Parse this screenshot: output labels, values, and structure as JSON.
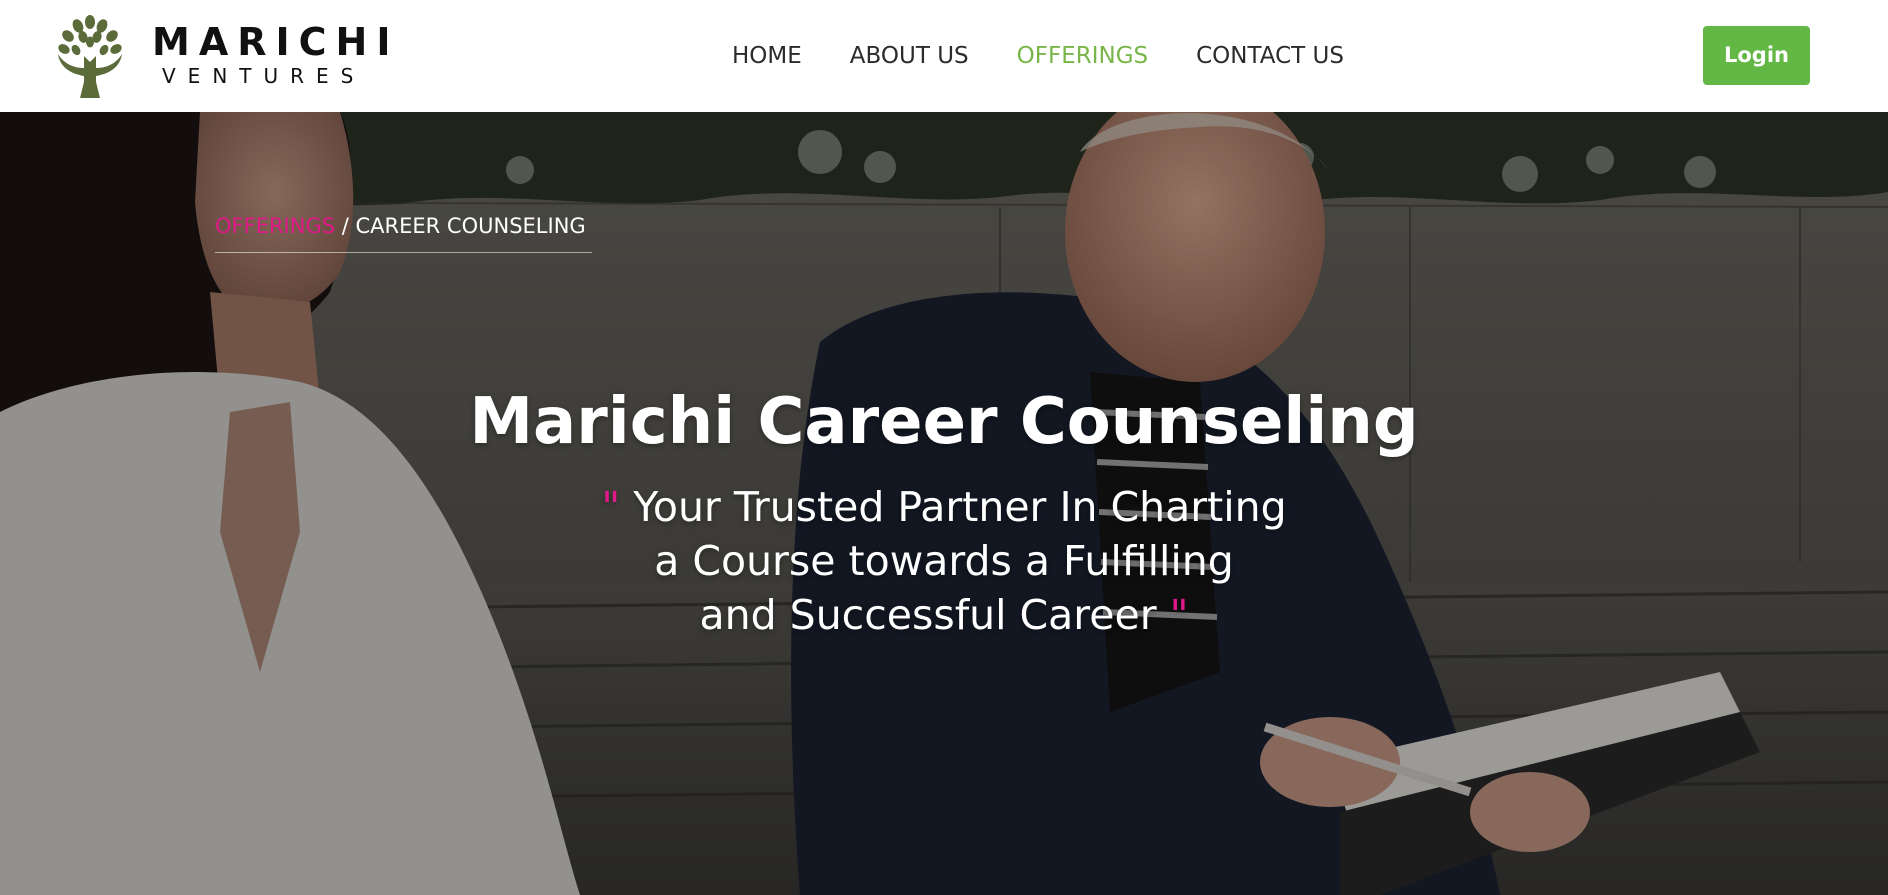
{
  "brand": {
    "name": "MARICHI",
    "tagline": "VENTURES",
    "logo_icon": "tree-hands-icon",
    "logo_color": "#5b6b3a"
  },
  "nav": {
    "items": [
      {
        "label": "HOME",
        "active": false
      },
      {
        "label": "ABOUT US",
        "active": false
      },
      {
        "label": "OFFERINGS",
        "active": true
      },
      {
        "label": "CONTACT US",
        "active": false
      }
    ],
    "active_color": "#79b64a",
    "login_label": "Login",
    "login_color": "#63b744"
  },
  "hero": {
    "breadcrumb": {
      "link": "OFFERINGS",
      "separator": " / ",
      "current": "CAREER COUNSELING",
      "link_color": "#e0198a"
    },
    "title": "Marichi Career Counseling",
    "quote_open": "\"",
    "quote_close": "\"",
    "quote_lines": [
      "Your Trusted Partner In Charting",
      "a Course towards a Fulfilling",
      "and Successful Career"
    ],
    "quote_mark_color": "#e0198a"
  }
}
